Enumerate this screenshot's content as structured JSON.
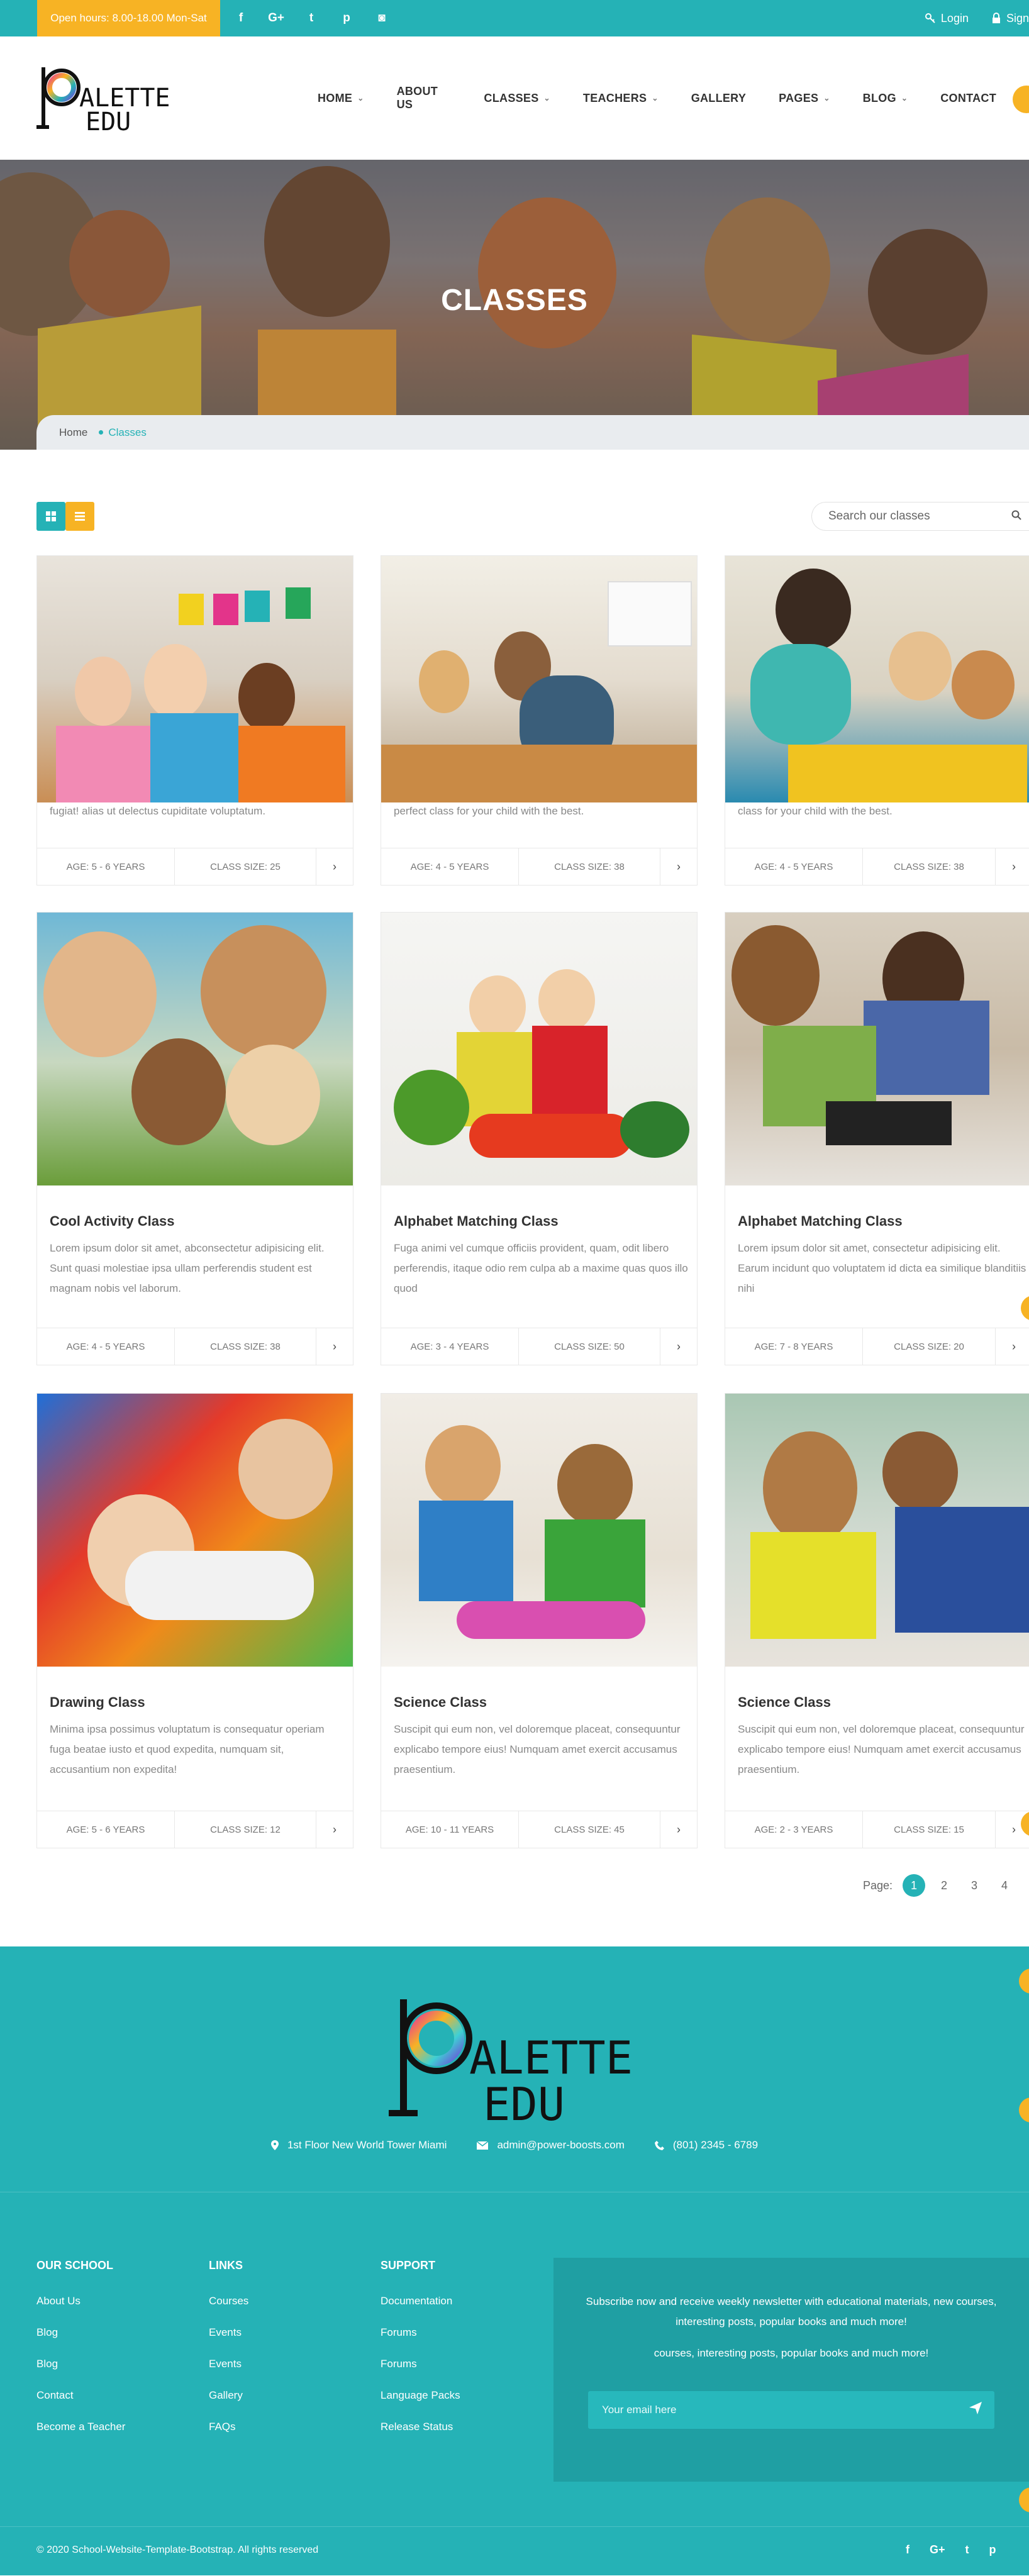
{
  "topbar": {
    "hours": "Open hours: 8.00-18.00 Mon-Sat",
    "social": [
      "facebook-icon",
      "google-plus-icon",
      "twitter-icon",
      "pinterest-icon",
      "instagram-icon"
    ],
    "social_glyphs": [
      "f",
      "G+",
      "t",
      "p",
      "◙"
    ],
    "login": "Login",
    "signup": "Sign"
  },
  "brand": {
    "line1": "ALETTE",
    "line2": "EDU"
  },
  "nav": [
    {
      "label": "HOME",
      "dropdown": true
    },
    {
      "label": "ABOUT US",
      "dropdown": false
    },
    {
      "label": "CLASSES",
      "dropdown": true
    },
    {
      "label": "TEACHERS",
      "dropdown": true
    },
    {
      "label": "GALLERY",
      "dropdown": false
    },
    {
      "label": "PAGES",
      "dropdown": true
    },
    {
      "label": "BLOG",
      "dropdown": true
    },
    {
      "label": "CONTACT",
      "dropdown": false
    }
  ],
  "hero": {
    "title": "CLASSES"
  },
  "breadcrumb": {
    "home": "Home",
    "current": "Classes"
  },
  "search": {
    "placeholder": "Search our classes"
  },
  "cards": [
    {
      "title": "",
      "desc": "fugiat! alias ut delectus cupiditate voluptatum.",
      "age": "AGE: 5 - 6 YEARS",
      "size": "CLASS SIZE: 25"
    },
    {
      "title": "",
      "desc": "perfect class for your child with the best.",
      "age": "AGE: 4 - 5 YEARS",
      "size": "CLASS SIZE: 38"
    },
    {
      "title": "",
      "desc": "class for your child with the best.",
      "age": "AGE: 4 - 5 YEARS",
      "size": "CLASS SIZE: 38"
    },
    {
      "title": "Cool Activity Class",
      "desc": "Lorem ipsum dolor sit amet, abconsectetur adipisicing elit. Sunt quasi molestiae ipsa ullam perferendis student est magnam nobis vel laborum.",
      "age": "AGE: 4 - 5 YEARS",
      "size": "CLASS SIZE: 38"
    },
    {
      "title": "Alphabet Matching Class",
      "desc": "Fuga animi vel cumque officiis provident, quam, odit libero perferendis, itaque odio rem culpa ab a maxime quas quos illo quod",
      "age": "AGE: 3 - 4 YEARS",
      "size": "CLASS SIZE: 50"
    },
    {
      "title": "Alphabet Matching Class",
      "desc": "Lorem ipsum dolor sit amet, consectetur adipisicing elit. Earum incidunt quo voluptatem id dicta ea similique blanditiis nihi",
      "age": "AGE: 7 - 8 YEARS",
      "size": "CLASS SIZE: 20"
    },
    {
      "title": "Drawing Class",
      "desc": "Minima ipsa possimus voluptatum is consequatur operiam fuga beatae iusto et quod expedita, numquam sit, accusantium non expedita!",
      "age": "AGE: 5 - 6 YEARS",
      "size": "CLASS SIZE: 12"
    },
    {
      "title": "Science Class",
      "desc": "Suscipit qui eum non, vel doloremque placeat, consequuntur explicabo tempore eius! Numquam amet exercit accusamus praesentium.",
      "age": "AGE: 10 - 11 YEARS",
      "size": "CLASS SIZE: 45"
    },
    {
      "title": "Science Class",
      "desc": "Suscipit qui eum non, vel doloremque placeat, consequuntur explicabo tempore eius! Numquam amet exercit accusamus praesentium.",
      "age": "AGE: 2 - 3 YEARS",
      "size": "CLASS SIZE: 15"
    }
  ],
  "pagination": {
    "label": "Page:",
    "pages": [
      "1",
      "2",
      "3",
      "4"
    ],
    "active": "1"
  },
  "footer": {
    "address": "1st Floor New World Tower Miami",
    "email": "admin@power-boosts.com",
    "phone": "(801) 2345 - 6789",
    "cols": [
      {
        "title": "OUR SCHOOL",
        "links": [
          "About Us",
          "Blog",
          "Blog",
          "Contact",
          "Become a Teacher"
        ]
      },
      {
        "title": "LINKS",
        "links": [
          "Courses",
          "Events",
          "Events",
          "Gallery",
          "FAQs"
        ]
      },
      {
        "title": "SUPPORT",
        "links": [
          "Documentation",
          "Forums",
          "Forums",
          "Language Packs",
          "Release Status"
        ]
      }
    ],
    "newsletter_text": "Subscribe now and receive weekly newsletter with educational materials, new courses, interesting posts, popular books and much more!",
    "newsletter_text2": "courses, interesting posts, popular books and much more!",
    "email_placeholder": "Your email here",
    "copyright": "© 2020 School-Website-Template-Bootstrap. All rights reserved",
    "social": [
      "facebook-icon",
      "google-plus-icon",
      "twitter-icon",
      "pinterest-icon"
    ],
    "social_glyphs": [
      "f",
      "G+",
      "t",
      "p"
    ]
  },
  "colors": {
    "teal": "#25b2b6",
    "yellow": "#f7b324",
    "dark_teal": "#1f9fa3"
  }
}
